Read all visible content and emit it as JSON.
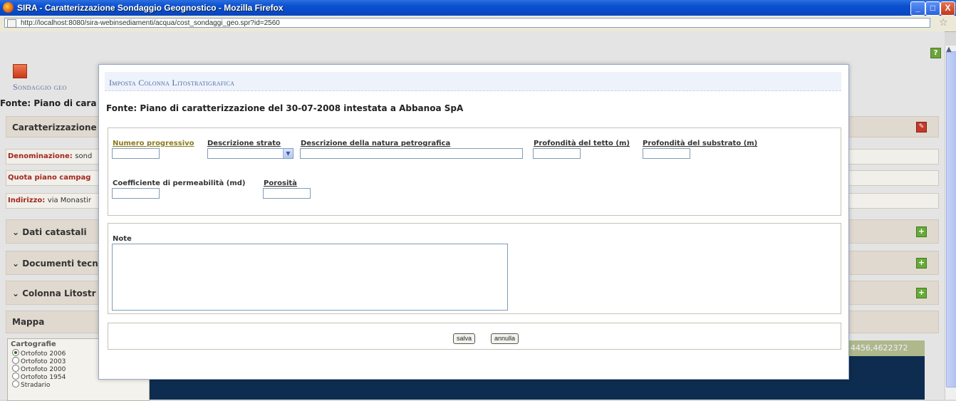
{
  "window": {
    "title": "SIRA - Caratterizzazione Sondaggio Geognostico - Mozilla Firefox",
    "url": "http://localhost:8080/sira-webinsediamenti/acqua/cost_sondaggi_geo.spr?id=2560",
    "min_label": "_",
    "max_label": "□",
    "close_label": "X"
  },
  "background": {
    "header_title": "Sondaggio geo",
    "fonte": "Fonte: Piano di cara",
    "caratterizzazione": "Caratterizzazione",
    "denominazione_label": "Denominazione:",
    "denominazione_value": "sond",
    "quota_label": "Quota piano campag",
    "indirizzo_label": "Indirizzo:",
    "indirizzo_value": "via Monastir",
    "dati_catastali": "Dati catastali",
    "documenti_tecnici": "Documenti tecn",
    "colonna_litostratigrafica": "Colonna Litostr",
    "mappa": "Mappa",
    "map_coords": "4456,4622372",
    "cartografie": {
      "title": "Cartografie",
      "options": [
        "Ortofoto 2006",
        "Ortofoto 2003",
        "Ortofoto 2000",
        "Ortofoto 1954",
        "Stradario"
      ],
      "selected": "Ortofoto 2006"
    }
  },
  "modal": {
    "title": "Imposta Colonna Litostratigrafica",
    "fonte": "Fonte: Piano di caratterizzazione del 30-07-2008 intestata a Abbanoa SpA",
    "fields": {
      "numero_progressivo": "Numero progressivo",
      "descrizione_strato": "Descrizione strato",
      "descrizione_natura": "Descrizione della natura petrografica",
      "profondita_tetto": "Profondità del tetto (m)",
      "profondita_substrato": "Profondità del substrato (m)",
      "coefficiente": "Coefficiente di permeabilità (md)",
      "porosita": "Porosità",
      "note": "Note"
    },
    "values": {
      "numero_progressivo": "",
      "descrizione_strato": "",
      "descrizione_natura": "",
      "profondita_tetto": "",
      "profondita_substrato": "",
      "coefficiente": "",
      "porosita": "",
      "note": ""
    },
    "buttons": {
      "salva": "salva",
      "annulla": "annulla"
    }
  }
}
